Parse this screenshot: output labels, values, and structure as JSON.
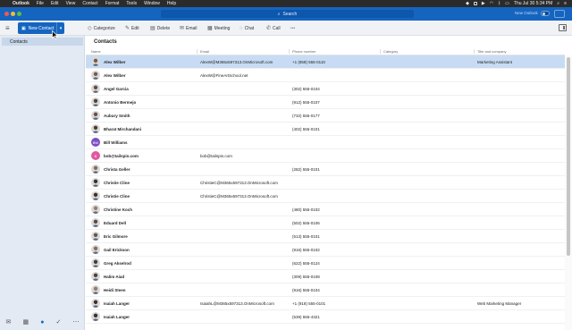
{
  "menubar": {
    "apple": "",
    "app": "Outlook",
    "items": [
      "File",
      "Edit",
      "View",
      "Contact",
      "Format",
      "Tools",
      "Window",
      "Help"
    ],
    "clock": "Thu Jul 30  5:34 PM"
  },
  "titlebar": {
    "search_placeholder": "Search",
    "new_outlook": "New Outlook"
  },
  "toolbar": {
    "new_contact": "New Contact",
    "categorize": "Categorize",
    "edit": "Edit",
    "delete": "Delete",
    "email": "Email",
    "meeting": "Meeting",
    "chat": "Chat",
    "call": "Call",
    "more": "•••"
  },
  "sidebar": {
    "contacts": "Contacts"
  },
  "main": {
    "title": "Contacts",
    "columns": {
      "name": "Name",
      "email": "Email",
      "phone": "Phone number",
      "category": "Category",
      "title": "Title and company"
    }
  },
  "contacts": [
    {
      "name": "Alex Wilber",
      "email": "AlexW@M365x597313.OnMicrosoft.com",
      "phone": "+1 (858) 555-0110",
      "category": "",
      "title": "Marketing Assistant",
      "avatar": "photo",
      "color": "#7a5a48",
      "selected": true
    },
    {
      "name": "Alex Wilber",
      "email": "AlexW@FineArtSchool.net",
      "phone": "",
      "category": "",
      "title": "",
      "avatar": "photo",
      "color": "#7a5a48"
    },
    {
      "name": "Angel Garcia",
      "email": "",
      "phone": "(302) 555-0104",
      "category": "",
      "title": "",
      "avatar": "photo",
      "color": "#6b4b3a"
    },
    {
      "name": "Antonio Bermejo",
      "email": "",
      "phone": "(912) 555-0107",
      "category": "",
      "title": "",
      "avatar": "photo",
      "color": "#5a4030"
    },
    {
      "name": "Aubury Smith",
      "email": "",
      "phone": "(732) 555-0177",
      "category": "",
      "title": "",
      "avatar": "photo",
      "color": "#6e5040"
    },
    {
      "name": "Bharat Mirchandani",
      "email": "",
      "phone": "(402) 555-0101",
      "category": "",
      "title": "",
      "avatar": "photo",
      "color": "#4e3a2c"
    },
    {
      "name": "Bill Williams",
      "email": "",
      "phone": "",
      "category": "",
      "title": "",
      "avatar": "BW",
      "color": "#7b4fc4"
    },
    {
      "name": "bob@tailspin.com",
      "email": "bob@tailspin.com",
      "phone": "",
      "category": "",
      "title": "",
      "avatar": "B",
      "color": "#e05a9e"
    },
    {
      "name": "Christa Geller",
      "email": "",
      "phone": "(282) 555-0101",
      "category": "",
      "title": "",
      "avatar": "photo",
      "color": "#8a6a55"
    },
    {
      "name": "Christie Cline",
      "email": "ChristieC@M365x597313.OnMicrosoft.com",
      "phone": "",
      "category": "",
      "title": "",
      "avatar": "photo",
      "color": "#3e2f28"
    },
    {
      "name": "Christie Cline",
      "email": "ChristieC@M365x597313.OnMicrosoft.com",
      "phone": "",
      "category": "",
      "title": "",
      "avatar": "photo",
      "color": "#3e2f28"
    },
    {
      "name": "Christine Koch",
      "email": "",
      "phone": "(480) 555-0102",
      "category": "",
      "title": "",
      "avatar": "photo",
      "color": "#a07c62"
    },
    {
      "name": "Eduard Dell",
      "email": "",
      "phone": "(502) 555-0106",
      "category": "",
      "title": "",
      "avatar": "photo",
      "color": "#5d4a3e"
    },
    {
      "name": "Eric Gilmore",
      "email": "",
      "phone": "(513) 555-0101",
      "category": "",
      "title": "",
      "avatar": "photo",
      "color": "#6a5444"
    },
    {
      "name": "Gail Erickson",
      "email": "",
      "phone": "(916) 555-0102",
      "category": "",
      "title": "",
      "avatar": "photo",
      "color": "#8b6b56"
    },
    {
      "name": "Greg Akselrod",
      "email": "",
      "phone": "(622) 555-0124",
      "category": "",
      "title": "",
      "avatar": "photo",
      "color": "#4a3a30"
    },
    {
      "name": "Halim Aiad",
      "email": "",
      "phone": "(309) 555-0108",
      "category": "",
      "title": "",
      "avatar": "photo",
      "color": "#55402f"
    },
    {
      "name": "Heidi Steen",
      "email": "",
      "phone": "(916) 555-0104",
      "category": "",
      "title": "",
      "avatar": "photo",
      "color": "#9a7a66"
    },
    {
      "name": "Isaiah Langer",
      "email": "IsaiahL@M365x597313.OnMicrosoft.com",
      "phone": "+1 (918) 555-0101",
      "category": "",
      "title": "Web Marketing Manager",
      "avatar": "photo",
      "color": "#3f3028"
    },
    {
      "name": "Isaiah Langer",
      "email": "",
      "phone": "(539) 555-4321",
      "category": "",
      "title": "",
      "avatar": "photo",
      "color": "#3f3028"
    }
  ]
}
